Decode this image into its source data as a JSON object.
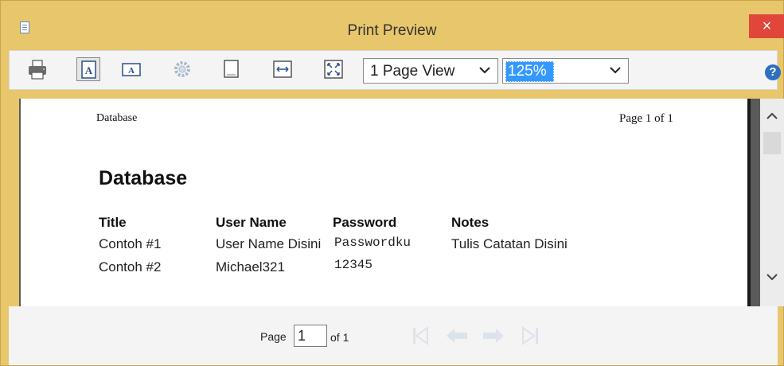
{
  "window": {
    "title": "Print Preview",
    "close_glyph": "×"
  },
  "toolbar": {
    "icons": [
      "printer-icon",
      "portrait-icon",
      "landscape-icon",
      "settings-gear-icon",
      "whole-page-icon",
      "page-width-icon",
      "fit-page-icon"
    ],
    "view_mode": "1 Page View",
    "zoom": "125%",
    "help_glyph": "?"
  },
  "page": {
    "header_left": "Database",
    "header_right": "Page 1 of 1",
    "title": "Database",
    "columns": [
      "Title",
      "User Name",
      "Password",
      "Notes"
    ],
    "rows": [
      [
        "Contoh #1",
        "User Name Disini",
        "Passwordku",
        "Tulis Catatan Disini"
      ],
      [
        "Contoh #2",
        "Michael321",
        "12345",
        ""
      ]
    ]
  },
  "footer": {
    "page_label": "Page",
    "page_value": "1",
    "of_label": "of 1"
  },
  "colors": {
    "title_bar": "#e8c66b",
    "close_button": "#e0463a",
    "zoom_highlight": "#3399ff"
  }
}
